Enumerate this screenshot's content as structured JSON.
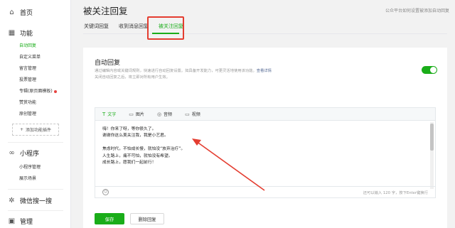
{
  "sidebar": {
    "home": {
      "label": "首页",
      "icon": "home-icon"
    },
    "features": {
      "label": "功能",
      "icon": "grid-icon"
    },
    "feature_items": [
      {
        "label": "自动回复",
        "active": true
      },
      {
        "label": "自定义菜单"
      },
      {
        "label": "留言管理"
      },
      {
        "label": "投票管理"
      },
      {
        "label": "专辑(原页面模板)",
        "dot": true
      },
      {
        "label": "赞赏功能"
      },
      {
        "label": "原创管理"
      }
    ],
    "add_plugin": "添加功能插件",
    "miniprogram": {
      "label": "小程序",
      "icon": "link-icon"
    },
    "mini_items": [
      {
        "label": "小程序管理"
      },
      {
        "label": "展示场景"
      }
    ],
    "wechat_search": {
      "label": "微信搜一搜",
      "icon": "sparkle-icon"
    },
    "manage": {
      "label": "管理",
      "icon": "manage-icon"
    }
  },
  "page": {
    "title": "被关注回复",
    "top_right_link": "公众平台如何设置被添加自动回复"
  },
  "tabs": [
    {
      "label": "关键词回复"
    },
    {
      "label": "收到消息回复"
    },
    {
      "label": "被关注回复",
      "active": true
    }
  ],
  "auto_reply": {
    "title": "自动回复",
    "desc_line1": "通过编辑内容或关键词规则，快速进行自动回复设置。如具备开发能力，可更灵活地使用该功能。",
    "desc_link": "查看详情",
    "desc_line2": "关闭自动回复之后，将立即对所有用户生效。",
    "enabled": true
  },
  "editor": {
    "tools": [
      {
        "label": "文字",
        "icon": "text-icon",
        "active": true
      },
      {
        "label": "图片",
        "icon": "image-icon"
      },
      {
        "label": "音频",
        "icon": "audio-icon"
      },
      {
        "label": "视频",
        "icon": "video-icon"
      }
    ],
    "content": "嗨！你来了呀，等你很久了。\n谢谢你这么美关注我，我是小艺君。\n\n焦虑时代，不怕成长慢，就怕没“放弃治疗”。\n人生路上，痛不可怕，就怕没有希望。\n成长路上，愿我们一起前行！",
    "hint": "还可以输入 120 字，按下Enter键换行"
  },
  "actions": {
    "save": "保存",
    "delete": "删除回复"
  },
  "colors": {
    "accent": "#1aad19",
    "highlight": "#e43d30"
  }
}
